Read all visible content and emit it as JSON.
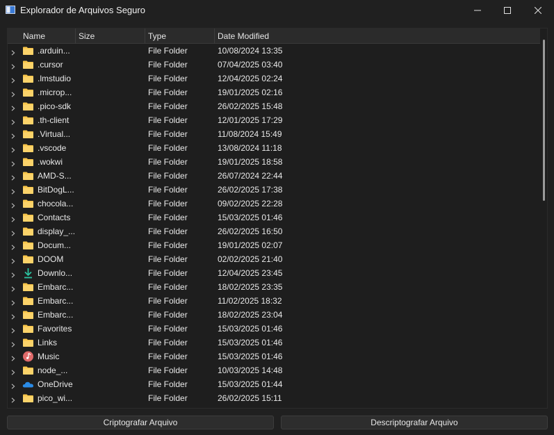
{
  "window": {
    "title": "Explorador de Arquivos Seguro",
    "controls": [
      "minimize-icon",
      "maximize-icon",
      "close-icon"
    ]
  },
  "tree": {
    "columns": [
      "Name",
      "Size",
      "Type",
      "Date Modified"
    ],
    "rows": [
      {
        "name": ".arduin...",
        "type": "File Folder",
        "date": "10/08/2024 13:35",
        "icon": "folder-icon"
      },
      {
        "name": ".cursor",
        "type": "File Folder",
        "date": "07/04/2025 03:40",
        "icon": "folder-icon"
      },
      {
        "name": ".lmstudio",
        "type": "File Folder",
        "date": "12/04/2025 02:24",
        "icon": "folder-icon"
      },
      {
        "name": ".microp...",
        "type": "File Folder",
        "date": "19/01/2025 02:16",
        "icon": "folder-icon"
      },
      {
        "name": ".pico-sdk",
        "type": "File Folder",
        "date": "26/02/2025 15:48",
        "icon": "folder-icon"
      },
      {
        "name": ".th-client",
        "type": "File Folder",
        "date": "12/01/2025 17:29",
        "icon": "folder-icon"
      },
      {
        "name": ".Virtual...",
        "type": "File Folder",
        "date": "11/08/2024 15:49",
        "icon": "folder-icon"
      },
      {
        "name": ".vscode",
        "type": "File Folder",
        "date": "13/08/2024 11:18",
        "icon": "folder-icon"
      },
      {
        "name": ".wokwi",
        "type": "File Folder",
        "date": "19/01/2025 18:58",
        "icon": "folder-icon"
      },
      {
        "name": "AMD-S...",
        "type": "File Folder",
        "date": "26/07/2024 22:44",
        "icon": "folder-icon"
      },
      {
        "name": "BitDogL...",
        "type": "File Folder",
        "date": "26/02/2025 17:38",
        "icon": "folder-icon"
      },
      {
        "name": "chocola...",
        "type": "File Folder",
        "date": "09/02/2025 22:28",
        "icon": "folder-icon"
      },
      {
        "name": "Contacts",
        "type": "File Folder",
        "date": "15/03/2025 01:46",
        "icon": "folder-icon"
      },
      {
        "name": "display_...",
        "type": "File Folder",
        "date": "26/02/2025 16:50",
        "icon": "folder-icon"
      },
      {
        "name": "Docum...",
        "type": "File Folder",
        "date": "19/01/2025 02:07",
        "icon": "folder-icon"
      },
      {
        "name": "DOOM",
        "type": "File Folder",
        "date": "02/02/2025 21:40",
        "icon": "folder-icon"
      },
      {
        "name": "Downlo...",
        "type": "File Folder",
        "date": "12/04/2025 23:45",
        "icon": "download-icon"
      },
      {
        "name": "Embarc...",
        "type": "File Folder",
        "date": "18/02/2025 23:35",
        "icon": "folder-icon"
      },
      {
        "name": "Embarc...",
        "type": "File Folder",
        "date": "11/02/2025 18:32",
        "icon": "folder-icon"
      },
      {
        "name": "Embarc...",
        "type": "File Folder",
        "date": "18/02/2025 23:04",
        "icon": "folder-icon"
      },
      {
        "name": "Favorites",
        "type": "File Folder",
        "date": "15/03/2025 01:46",
        "icon": "folder-icon"
      },
      {
        "name": "Links",
        "type": "File Folder",
        "date": "15/03/2025 01:46",
        "icon": "folder-icon"
      },
      {
        "name": "Music",
        "type": "File Folder",
        "date": "15/03/2025 01:46",
        "icon": "music-icon"
      },
      {
        "name": "node_...",
        "type": "File Folder",
        "date": "10/03/2025 14:48",
        "icon": "folder-icon"
      },
      {
        "name": "OneDrive",
        "type": "File Folder",
        "date": "15/03/2025 01:44",
        "icon": "onedrive-icon"
      },
      {
        "name": "pico_wi...",
        "type": "File Folder",
        "date": "26/02/2025 15:11",
        "icon": "folder-icon"
      },
      {
        "name": "",
        "type": "",
        "date": "",
        "icon": "folder-icon"
      }
    ]
  },
  "actions": {
    "encrypt_label": "Criptografar Arquivo",
    "decrypt_label": "Descriptografar Arquivo"
  },
  "colors": {
    "background": "#202020",
    "panel": "#1e1e1e",
    "header": "#2b2b2b",
    "folder": "#f8c54a",
    "download": "#2bc3a0",
    "music": "#e06b6b",
    "onedrive": "#2a8be6"
  }
}
